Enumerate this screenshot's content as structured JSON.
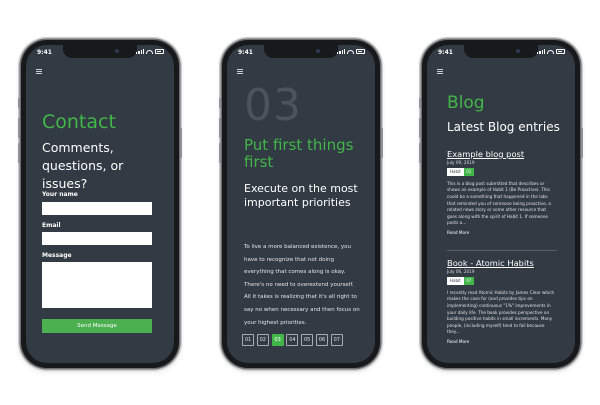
{
  "status": {
    "time": "9:41"
  },
  "colors": {
    "accent": "#43b649",
    "screen_bg": "#323a44"
  },
  "contact": {
    "title": "Contact",
    "subtitle": "Comments, questions, or issues?",
    "name_label": "Your name",
    "email_label": "Email",
    "message_label": "Message",
    "name_value": "",
    "email_value": "",
    "message_value": "",
    "send_label": "Send Message"
  },
  "habit": {
    "number": "03",
    "title": "Put first things first",
    "subtitle": "Execute on the most important priorities",
    "body": "To live a more balanced existence, you have to recognize that not doing everything that comes along is okay. There's no need to overextend yourself. All it takes is realizing that it's all right to say no when necessary and then focus on your highest priorities.",
    "pages": [
      "01",
      "02",
      "03",
      "04",
      "05",
      "06",
      "07"
    ],
    "active_page": "03"
  },
  "blog": {
    "title": "Blog",
    "subtitle": "Latest Blog entries",
    "posts": [
      {
        "title": "Example blog post",
        "date": "July 09, 2019",
        "tag": "Habit",
        "tag_number": "01",
        "excerpt": "This is a blog post submitted that describes or shows an example of Habit 1 (Be Proactive). This could be a something that happened in the labs that reminded you of someone being proactive, a related news story or some other resource that goes along with the spirit of Habit 1. If someone posts a...",
        "read_more": "Read More"
      },
      {
        "title": "Book - Atomic Habits",
        "date": "July 06, 2019",
        "tag": "Habit",
        "tag_number": "07",
        "excerpt": "I recently read Atomic Habits by James Clear which makes the case for (and provides tips on implementing) continuous \"1%\" improvements in your daily life. The book provides perspective on building positive habits in small increments. Many people, (including myself) tend to fail because they...",
        "read_more": "Read More"
      }
    ]
  }
}
